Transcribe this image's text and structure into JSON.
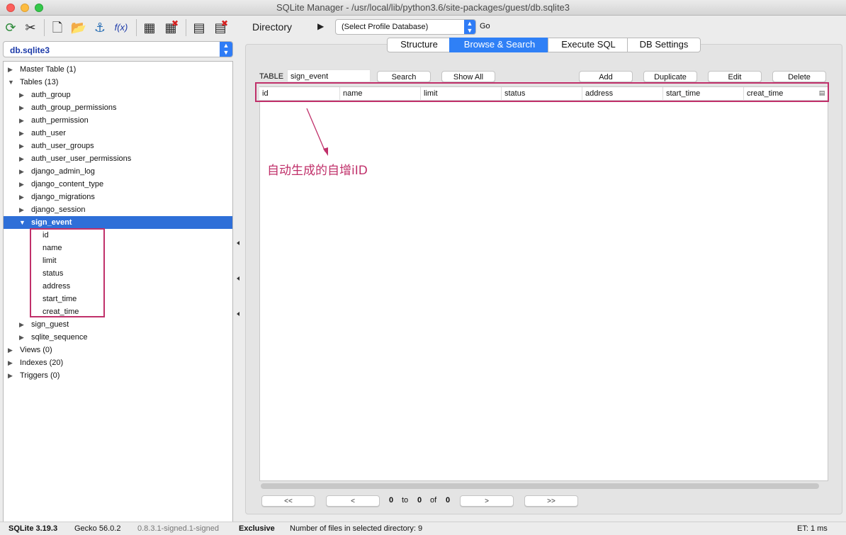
{
  "window": {
    "title": "SQLite Manager - /usr/local/lib/python3.6/site-packages/guest/db.sqlite3"
  },
  "toolbar": {
    "icons": [
      "reload-icon",
      "tools-icon",
      "new-file-icon",
      "open-folder-icon",
      "attach-icon",
      "function-icon",
      "new-table-icon",
      "drop-table-icon",
      "new-index-icon",
      "drop-index-icon"
    ],
    "function_label": "f(x)",
    "directory_label": "Directory",
    "profile_select": "(Select Profile Database)",
    "go_label": "Go"
  },
  "sidebar": {
    "db_select": "db.sqlite3",
    "tree": {
      "master": "Master Table (1)",
      "tables": "Tables (13)",
      "table_items": [
        "auth_group",
        "auth_group_permissions",
        "auth_permission",
        "auth_user",
        "auth_user_groups",
        "auth_user_user_permissions",
        "django_admin_log",
        "django_content_type",
        "django_migrations",
        "django_session"
      ],
      "selected_table": "sign_event",
      "fields": [
        "id",
        "name",
        "limit",
        "status",
        "address",
        "start_time",
        "creat_time"
      ],
      "after_items": [
        "sign_guest",
        "sqlite_sequence"
      ],
      "views": "Views (0)",
      "indexes": "Indexes (20)",
      "triggers": "Triggers (0)"
    }
  },
  "tabs": [
    {
      "label": "Structure",
      "active": false
    },
    {
      "label": "Browse & Search",
      "active": true
    },
    {
      "label": "Execute SQL",
      "active": false
    },
    {
      "label": "DB Settings",
      "active": false
    }
  ],
  "browse": {
    "table_label": "TABLE",
    "table_name": "sign_event",
    "search": "Search",
    "show_all": "Show All",
    "add": "Add",
    "duplicate": "Duplicate",
    "edit": "Edit",
    "delete": "Delete",
    "columns": [
      "id",
      "name",
      "limit",
      "status",
      "address",
      "start_time",
      "creat_time"
    ]
  },
  "annotation": {
    "text": "自动生成的自增iID",
    "color": "#c0306a"
  },
  "pager": {
    "first": "<<",
    "prev": "<",
    "from": "0",
    "to_label": "to",
    "to": "0",
    "of_label": "of",
    "total": "0",
    "next": ">",
    "last": ">>"
  },
  "status": {
    "sqlite_version": "SQLite 3.19.3",
    "gecko": "Gecko 56.0.2",
    "ext_version": "0.8.3.1-signed.1-signed",
    "mode": "Exclusive",
    "files": "Number of files in selected directory: 9",
    "et": "ET: 1 ms"
  },
  "colors": {
    "accent": "#2f80f6",
    "highlight": "#c0306a",
    "selection": "#2e6fd8"
  }
}
